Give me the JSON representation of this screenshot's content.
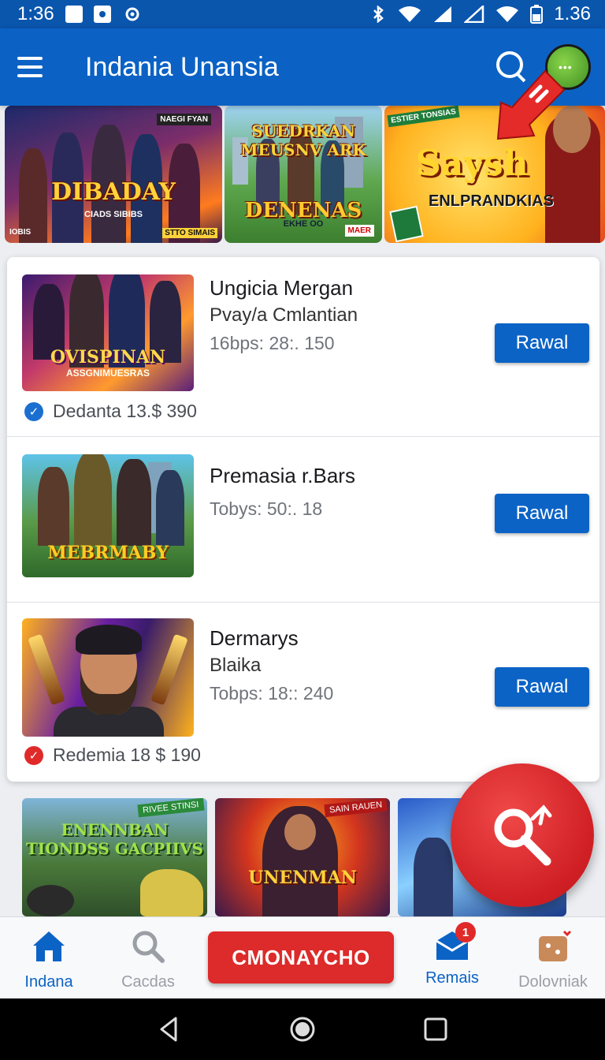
{
  "status_bar": {
    "time": "1:36",
    "battery": "1.36"
  },
  "app_bar": {
    "title": "Indania Unansia"
  },
  "banner": [
    {
      "title": "DIBADAY",
      "sub": "CIADS SIBIBS",
      "corner": "NAEGI FYAN",
      "tag": "IOBIS",
      "tag2": "STTO SIMAIS"
    },
    {
      "title_top": "SUEDRKAN MEUSNV ARK",
      "title": "DENENAS",
      "sub": "EKHE OO",
      "corner": "MAER"
    },
    {
      "title": "Saysh",
      "sub": "ENLPRANDKIAS",
      "corner": "ESTIER TONSIAS"
    }
  ],
  "list": [
    {
      "title": "Ungicia Mergan",
      "subtitle": "Pvay/a Cmlantian",
      "meta": "16bps: 28:. 150",
      "button": "Rawal",
      "badge": "Dedanta 13.$ 390",
      "thumb_title": "OVISPINAN",
      "thumb_sub": "ASSGNIMUESRAS"
    },
    {
      "title": "Premasia r.Bars",
      "meta": "Tobys: 50:. 18",
      "button": "Rawal",
      "thumb_title": "MEBRMABY"
    },
    {
      "title": "Dermarys",
      "subtitle": "Blaika",
      "meta": "Tobps: 18:: 240",
      "button": "Rawal",
      "badge": "Redemia 18 $ 190"
    }
  ],
  "more": [
    {
      "title": "ENENNBAN TIONDSS GACPIIVS",
      "ribbon": "RIVEE STINSI"
    },
    {
      "title": "UNENMAN",
      "ribbon": "SAIN RAUEN"
    },
    {
      "title": ""
    }
  ],
  "bottom_nav": {
    "home": "Indana",
    "search": "Cacdas",
    "cta": "CMONAYCHO",
    "mail": "Remais",
    "mail_count": "1",
    "dl": "Dolovniak"
  },
  "colors": {
    "primary": "#0b62c4",
    "accent_red": "#dd2a2a",
    "status_bar": "#0a56ad"
  },
  "icons": [
    "menu-icon",
    "search-icon",
    "avatar",
    "home-icon",
    "mail-icon",
    "box-icon",
    "back-icon",
    "home-circle-icon",
    "recents-icon"
  ]
}
